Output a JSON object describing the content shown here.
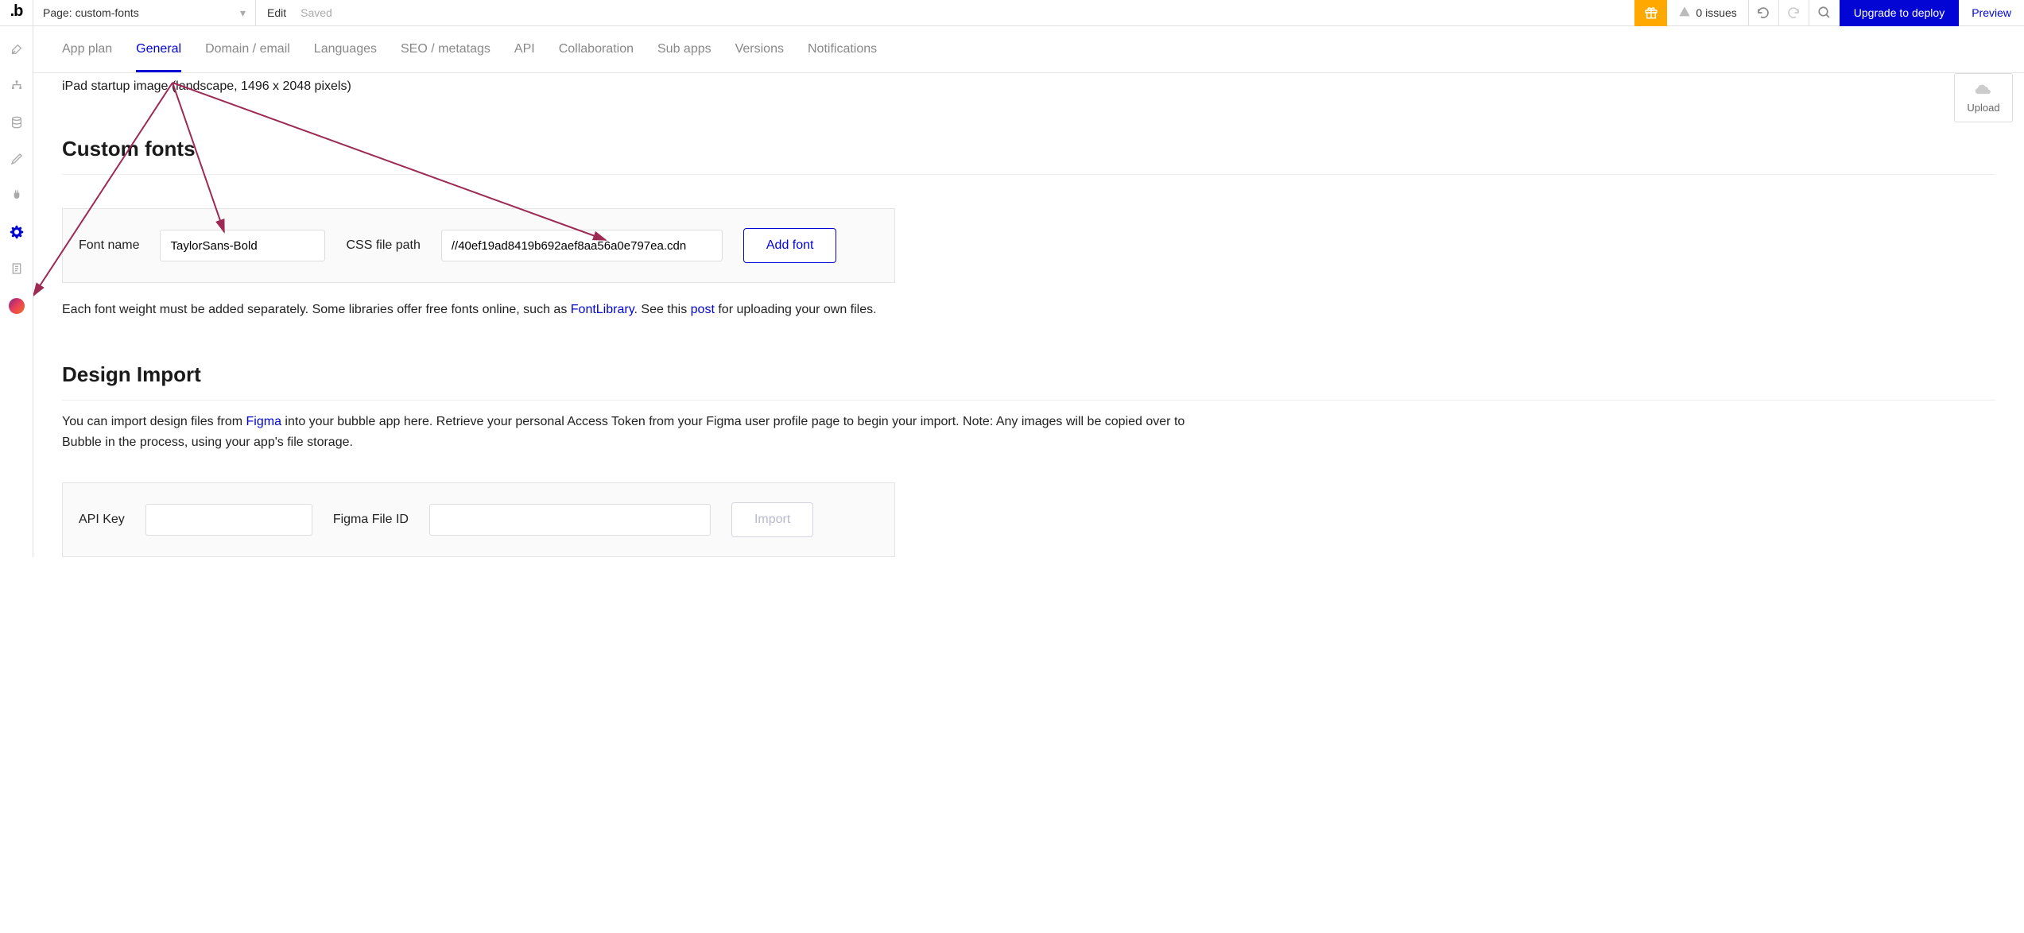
{
  "topbar": {
    "page_label_prefix": "Page:",
    "page_name": "custom-fonts",
    "edit": "Edit",
    "saved": "Saved",
    "issues_count": "0 issues",
    "upgrade": "Upgrade to deploy",
    "preview": "Preview"
  },
  "tabs": {
    "app_plan": "App plan",
    "general": "General",
    "domain_email": "Domain / email",
    "languages": "Languages",
    "seo": "SEO / metatags",
    "api": "API",
    "collaboration": "Collaboration",
    "sub_apps": "Sub apps",
    "versions": "Versions",
    "notifications": "Notifications"
  },
  "startup_line": "iPad startup image (landscape, 1496 x 2048 pixels)",
  "upload_label": "Upload",
  "custom_fonts": {
    "heading": "Custom fonts",
    "font_name_label": "Font name",
    "font_name_value": "TaylorSans-Bold",
    "css_path_label": "CSS file path",
    "css_path_value": "//40ef19ad8419b692aef8aa56a0e797ea.cdn",
    "add_font": "Add font",
    "desc_pre": "Each font weight must be added separately. Some libraries offer free fonts online, such as ",
    "link_fontlibrary": "FontLibrary",
    "desc_mid": ". See this ",
    "link_post": "post",
    "desc_post": " for uploading your own files."
  },
  "design_import": {
    "heading": "Design Import",
    "desc1_pre": "You can import design files from ",
    "link_figma": "Figma",
    "desc1_post": " into your bubble app here. Retrieve your personal Access Token from your Figma user profile page to begin your import. Note: Any images will be copied over to Bubble in the process, using your app's file storage.",
    "api_key_label": "API Key",
    "figma_id_label": "Figma File ID",
    "import_btn": "Import"
  }
}
